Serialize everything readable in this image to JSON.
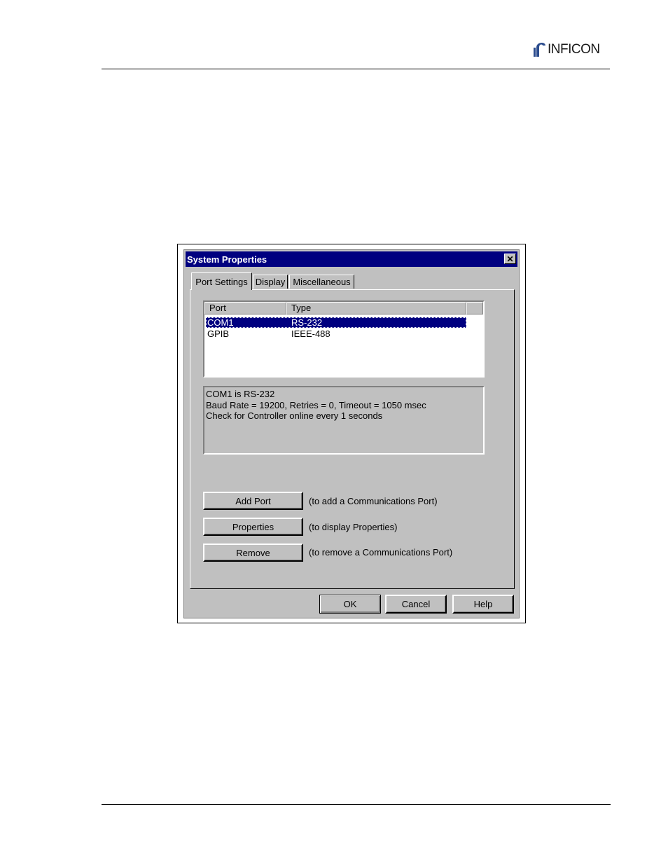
{
  "brand": {
    "name": "INFICON"
  },
  "dialog": {
    "title": "System Properties",
    "close_glyph": "✕",
    "tabs": [
      {
        "label": "Port Settings",
        "active": true
      },
      {
        "label": "Display",
        "active": false
      },
      {
        "label": "Miscellaneous",
        "active": false
      }
    ],
    "port_list": {
      "columns": [
        "Port",
        "Type"
      ],
      "rows": [
        {
          "port": "COM1",
          "type": "RS-232",
          "selected": true
        },
        {
          "port": "GPIB",
          "type": "IEEE-488",
          "selected": false
        }
      ]
    },
    "info_lines": [
      "COM1 is RS-232",
      "Baud Rate = 19200, Retries = 0, Timeout = 1050 msec",
      "Check for Controller online every 1 seconds"
    ],
    "actions": [
      {
        "label": "Add Port",
        "hint": "(to add a Communications Port)"
      },
      {
        "label": "Properties",
        "hint": "(to display Properties)"
      },
      {
        "label": "Remove",
        "hint": "(to remove a Communications Port)"
      }
    ],
    "footer": {
      "ok": "OK",
      "cancel": "Cancel",
      "help": "Help"
    }
  },
  "colors": {
    "titlebar": "#000080",
    "selection": "#000080",
    "face": "#c0c0c0"
  },
  "icons": {
    "brand_mark": "inficon-logo-icon",
    "close": "close-icon"
  }
}
